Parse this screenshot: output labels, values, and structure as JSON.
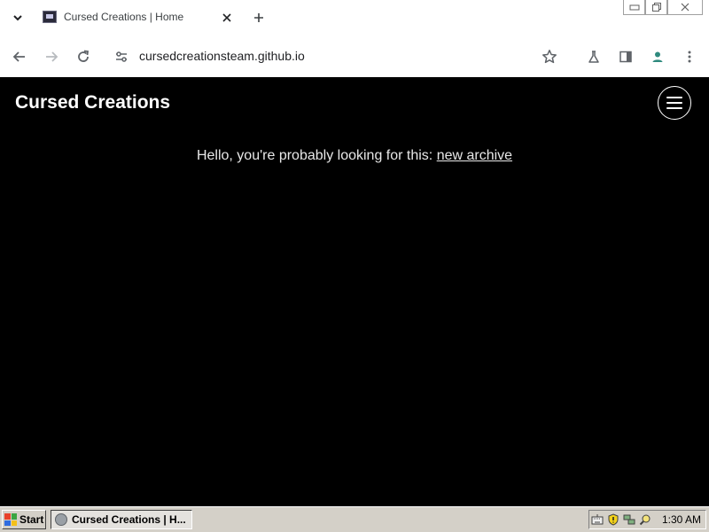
{
  "browser": {
    "tab": {
      "title": "Cursed Creations | Home"
    },
    "address_bar": {
      "url": "cursedcreationsteam.github.io"
    },
    "icons": {
      "tab_search": "chevron-down-icon",
      "tab_close": "close-icon",
      "new_tab": "plus-icon",
      "back": "arrow-left-icon",
      "forward": "arrow-right-icon",
      "reload": "reload-icon",
      "site_info": "tune-icon",
      "bookmark": "star-icon",
      "labs": "flask-icon",
      "side_panel": "side-panel-icon",
      "profile": "person-icon",
      "menu": "kebab-menu-icon"
    }
  },
  "page": {
    "site_title": "Cursed Creations",
    "message_prefix": "Hello, you're probably looking for this: ",
    "message_link": "new archive",
    "colors": {
      "background": "#000000",
      "text": "#e8e8e8"
    }
  },
  "taskbar": {
    "start_label": "Start",
    "task_item": "Cursed Creations | H...",
    "clock": "1:30 AM"
  }
}
